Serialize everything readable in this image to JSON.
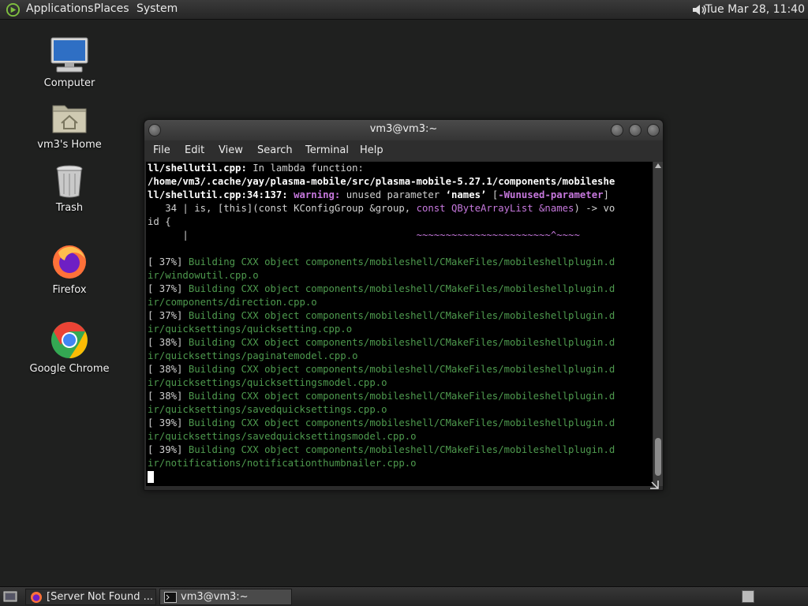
{
  "top_panel": {
    "menus": [
      "Applications",
      "Places",
      "System"
    ],
    "clock": "Tue Mar 28, 11:40",
    "icons": {
      "logo": "distro-logo-icon",
      "volume": "volume-icon"
    }
  },
  "desktop": {
    "icons": [
      {
        "label": "Computer",
        "icon": "computer-icon"
      },
      {
        "label": "vm3's Home",
        "icon": "home-folder-icon"
      },
      {
        "label": "Trash",
        "icon": "trash-icon"
      },
      {
        "label": "Firefox",
        "icon": "firefox-icon"
      },
      {
        "label": "Google Chrome",
        "icon": "chrome-icon"
      }
    ]
  },
  "terminal_window": {
    "title": "vm3@vm3:~",
    "menus": [
      "File",
      "Edit",
      "View",
      "Search",
      "Terminal",
      "Help"
    ],
    "lines": {
      "l1": "ll/shellutil.cpp:",
      "l1b": " In lambda function:",
      "l2": "/home/vm3/.cache/yay/plasma-mobile/src/plasma-mobile-5.27.1/components/mobileshe",
      "l3a": "ll/shellutil.cpp:34:137:",
      "l3b": " warning:",
      "l3c": " unused parameter ",
      "l3d": "‘names’",
      "l3e": " [",
      "l3f": "-Wunused-parameter",
      "l3g": "]",
      "l4a": "   34 | is, [this](const KConfigGroup &group, ",
      "l4b": "const QByteArrayList &names",
      "l4c": ") -> vo",
      "l5": "id {",
      "l6a": "      |                                       ",
      "l6b": "~~~~~~~~~~~~~~~~~~~~~~~^~~~~",
      "build": [
        {
          "pct": "[ 37%]",
          "text": " Building CXX object components/mobileshell/CMakeFiles/mobileshellplugin.d",
          "cont": "ir/windowutil.cpp.o"
        },
        {
          "pct": "[ 37%]",
          "text": " Building CXX object components/mobileshell/CMakeFiles/mobileshellplugin.d",
          "cont": "ir/components/direction.cpp.o"
        },
        {
          "pct": "[ 37%]",
          "text": " Building CXX object components/mobileshell/CMakeFiles/mobileshellplugin.d",
          "cont": "ir/quicksettings/quicksetting.cpp.o"
        },
        {
          "pct": "[ 38%]",
          "text": " Building CXX object components/mobileshell/CMakeFiles/mobileshellplugin.d",
          "cont": "ir/quicksettings/paginatemodel.cpp.o"
        },
        {
          "pct": "[ 38%]",
          "text": " Building CXX object components/mobileshell/CMakeFiles/mobileshellplugin.d",
          "cont": "ir/quicksettings/quicksettingsmodel.cpp.o"
        },
        {
          "pct": "[ 38%]",
          "text": " Building CXX object components/mobileshell/CMakeFiles/mobileshellplugin.d",
          "cont": "ir/quicksettings/savedquicksettings.cpp.o"
        },
        {
          "pct": "[ 39%]",
          "text": " Building CXX object components/mobileshell/CMakeFiles/mobileshellplugin.d",
          "cont": "ir/quicksettings/savedquicksettingsmodel.cpp.o"
        },
        {
          "pct": "[ 39%]",
          "text": " Building CXX object components/mobileshell/CMakeFiles/mobileshellplugin.d",
          "cont": "ir/notifications/notificationthumbnailer.cpp.o"
        }
      ]
    }
  },
  "taskbar": {
    "tasks": [
      {
        "label": "[Server Not Found ...",
        "icon": "firefox-icon"
      },
      {
        "label": "vm3@vm3:~",
        "icon": "terminal-icon"
      }
    ]
  },
  "colors": {
    "panel": "#2c2c2c",
    "desktop": "#1f201f",
    "terminal_bg": "#000000",
    "build_green": "#4e9a4e",
    "warning_magenta": "#c678dd"
  }
}
